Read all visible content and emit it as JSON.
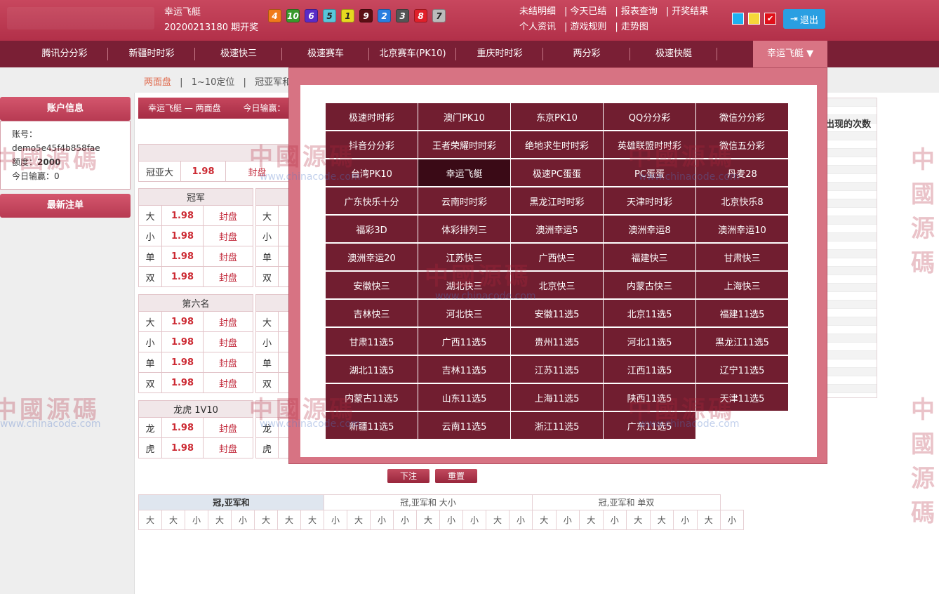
{
  "header": {
    "game_name": "幸运飞艇",
    "issue": "20200213180 期开奖",
    "balls": [
      {
        "n": "4",
        "color": "#f07a1a"
      },
      {
        "n": "10",
        "color": "#3a9a2c"
      },
      {
        "n": "6",
        "color": "#5a2cc7"
      },
      {
        "n": "5",
        "color": "#59c6d9"
      },
      {
        "n": "1",
        "color": "#e6d820"
      },
      {
        "n": "9",
        "color": "#5b0f14"
      },
      {
        "n": "2",
        "color": "#2a7fe0"
      },
      {
        "n": "3",
        "color": "#555555"
      },
      {
        "n": "8",
        "color": "#e0202a"
      },
      {
        "n": "7",
        "color": "#bbbbbb"
      }
    ],
    "links_row1": [
      "未结明细",
      "今天已结",
      "报表查询",
      "开奖结果"
    ],
    "links_row2": [
      "个人资讯",
      "游戏规则",
      "走势图"
    ],
    "colors": [
      "#1eb1f0",
      "#f5d73a",
      "#e0101a"
    ],
    "logout": "退出"
  },
  "nav": {
    "items": [
      "腾讯分分彩",
      "新疆时时彩",
      "极速快三",
      "极速赛车",
      "北京赛车(PK10)",
      "重庆时时彩",
      "两分彩",
      "极速快艇"
    ],
    "active": "幸运飞艇 ▼"
  },
  "subtabs": [
    "两面盘",
    "1~10定位",
    "冠亚军和"
  ],
  "sidebar": {
    "account_title": "账户信息",
    "account_label": "账号：",
    "account_value": "demo5e45f4b858fae",
    "quota_label": "额度：",
    "quota_value": "2000",
    "today_label": "今日输赢：0",
    "recent_title": "最新注单"
  },
  "main": {
    "head": "幸运飞艇 — 两面盘",
    "today": "今日输赢：",
    "sum_row": {
      "name": "冠亚大",
      "odds": "1.98",
      "status": "封盘"
    },
    "section1": "冠军",
    "section2": "第六名",
    "section3": "龙虎 1V10",
    "rows_dx": [
      {
        "name": "大",
        "odds": "1.98",
        "status": "封盘"
      },
      {
        "name": "小",
        "odds": "1.98",
        "status": "封盘"
      },
      {
        "name": "单",
        "odds": "1.98",
        "status": "封盘"
      },
      {
        "name": "双",
        "odds": "1.98",
        "status": "封盘"
      }
    ],
    "rows_lh": [
      {
        "name": "龙",
        "odds": "1.98",
        "status": "封盘"
      },
      {
        "name": "虎",
        "odds": "1.98",
        "status": "封盘"
      }
    ],
    "side_col_dx": [
      "大",
      "小",
      "单",
      "双"
    ],
    "side_col_lh": [
      "龙",
      "虎"
    ]
  },
  "games": [
    "极速时时彩",
    "澳门PK10",
    "东京PK10",
    "QQ分分彩",
    "微信分分彩",
    "抖音分分彩",
    "王者荣耀时时彩",
    "绝地求生时时彩",
    "英雄联盟时时彩",
    "微信五分彩",
    "台湾PK10",
    "幸运飞艇",
    "极速PC蛋蛋",
    "PC蛋蛋",
    "丹麦28",
    "广东快乐十分",
    "云南时时彩",
    "黑龙江时时彩",
    "天津时时彩",
    "北京快乐8",
    "福彩3D",
    "体彩排列三",
    "澳洲幸运5",
    "澳洲幸运8",
    "澳洲幸运10",
    "澳洲幸运20",
    "江苏快三",
    "广西快三",
    "福建快三",
    "甘肃快三",
    "安徽快三",
    "湖北快三",
    "北京快三",
    "内蒙古快三",
    "上海快三",
    "吉林快三",
    "河北快三",
    "安徽11选5",
    "北京11选5",
    "福建11选5",
    "甘肃11选5",
    "广西11选5",
    "贵州11选5",
    "河北11选5",
    "黑龙江11选5",
    "湖北11选5",
    "吉林11选5",
    "江苏11选5",
    "江西11选5",
    "辽宁11选5",
    "内蒙古11选5",
    "山东11选5",
    "上海11选5",
    "陕西11选5",
    "天津11选5",
    "新疆11选5",
    "云南11选5",
    "浙江11选5",
    "广东11选5"
  ],
  "games_selected": "幸运飞艇",
  "right_title": "出现的次数",
  "buttons": {
    "bet": "下注",
    "reset": "重置"
  },
  "history": {
    "h1": "冠,亚军和",
    "h2": "冠,亚军和 大小",
    "h3": "冠,亚军和 单双",
    "cells": [
      "大",
      "大",
      "小",
      "大",
      "小",
      "大",
      "大",
      "大",
      "小",
      "大",
      "小",
      "小",
      "大",
      "小",
      "小",
      "大",
      "小",
      "大",
      "小",
      "大",
      "小",
      "大",
      "大",
      "小",
      "大",
      "小"
    ]
  },
  "watermark": {
    "text": "中國源碼",
    "url": "www.chinacode.com"
  }
}
